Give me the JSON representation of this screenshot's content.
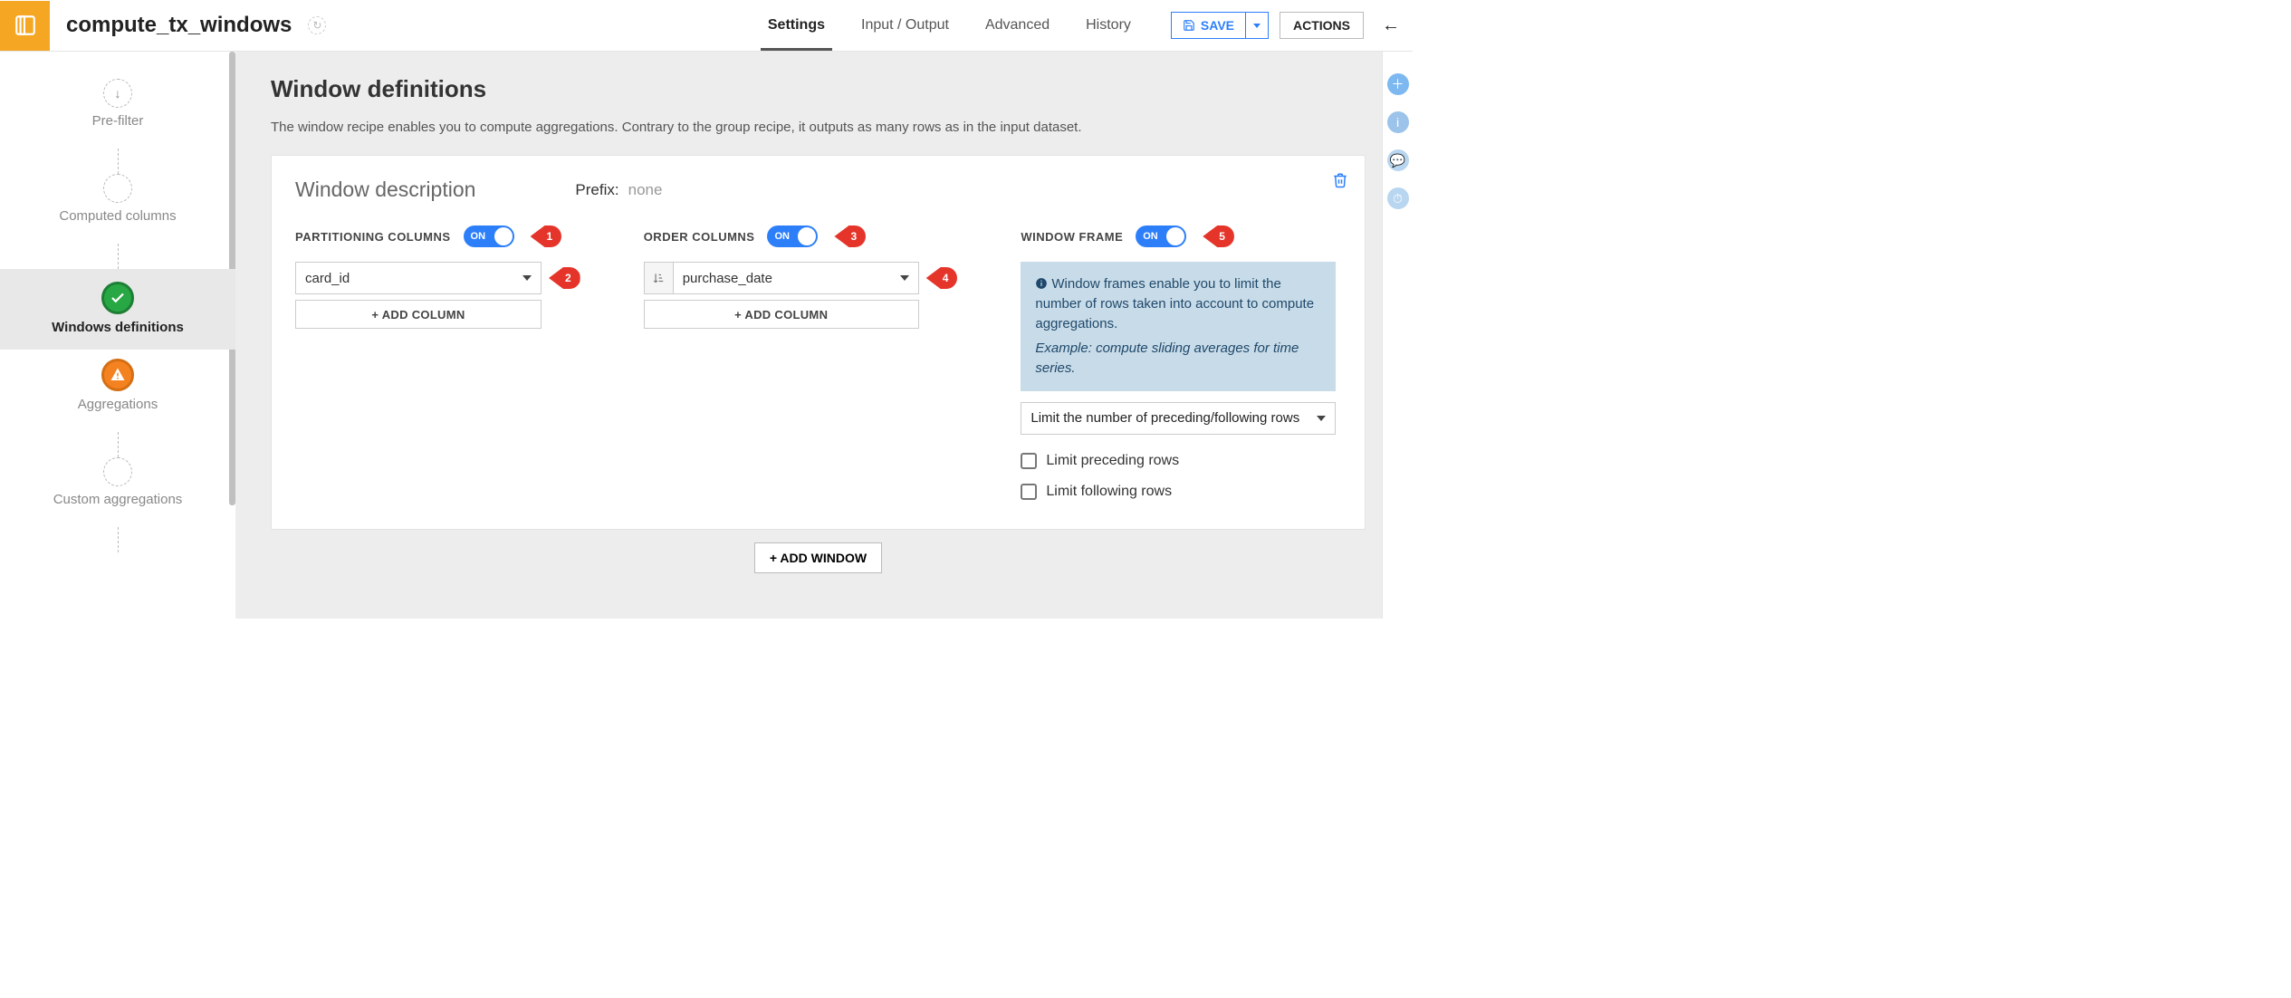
{
  "header": {
    "recipe_name": "compute_tx_windows",
    "tabs": [
      "Settings",
      "Input / Output",
      "Advanced",
      "History"
    ],
    "active_tab": 0,
    "save_label": "SAVE",
    "actions_label": "ACTIONS"
  },
  "sidebar": {
    "steps": [
      {
        "label": "Pre-filter",
        "status": "empty",
        "arrow": true
      },
      {
        "label": "Computed columns",
        "status": "empty"
      },
      {
        "label": "Windows definitions",
        "status": "ok",
        "active": true
      },
      {
        "label": "Aggregations",
        "status": "warn"
      },
      {
        "label": "Custom aggregations",
        "status": "empty"
      }
    ]
  },
  "main": {
    "title": "Window definitions",
    "description": "The window recipe enables you to compute aggregations. Contrary to the group recipe, it outputs as many rows as in the input dataset.",
    "card": {
      "heading": "Window description",
      "prefix_label": "Prefix:",
      "prefix_value": "none",
      "partition": {
        "title": "PARTITIONING COLUMNS",
        "toggle": "ON",
        "marker_head": "1",
        "column": "card_id",
        "marker_col": "2",
        "add_label": "+ ADD COLUMN"
      },
      "order": {
        "title": "ORDER COLUMNS",
        "toggle": "ON",
        "marker_head": "3",
        "column": "purchase_date",
        "marker_col": "4",
        "add_label": "+ ADD COLUMN"
      },
      "frame": {
        "title": "WINDOW FRAME",
        "toggle": "ON",
        "marker_head": "5",
        "info_text": "Window frames enable you to limit the number of rows taken into account to compute aggregations.",
        "info_example": "Example: compute sliding averages for time series.",
        "select_value": "Limit the number of preceding/following rows",
        "check_preceding": "Limit preceding rows",
        "check_following": "Limit following rows"
      }
    },
    "add_window_label": "+ ADD WINDOW"
  }
}
